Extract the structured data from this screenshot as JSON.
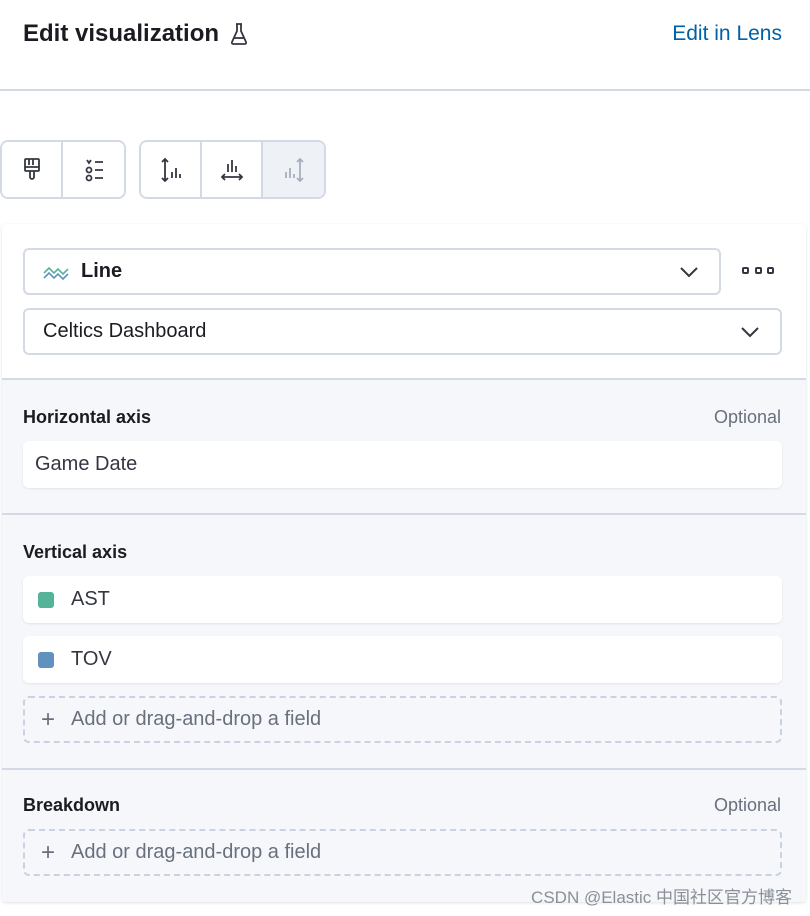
{
  "header": {
    "title": "Edit visualization",
    "edit_link": "Edit in Lens",
    "beaker_icon": "beaker-icon"
  },
  "toolbar": {
    "group1": [
      "paintbrush-icon",
      "legend-icon"
    ],
    "group2": [
      "left-axis-icon",
      "bottom-axis-icon",
      "right-axis-icon"
    ],
    "disabled": [
      "right-axis-icon"
    ]
  },
  "chart_type": {
    "label": "Line",
    "icon": "line-chart-icon"
  },
  "data_view": {
    "label": "Celtics Dashboard"
  },
  "horizontal_axis": {
    "title": "Horizontal axis",
    "optional": "Optional",
    "field": "Game Date"
  },
  "vertical_axis": {
    "title": "Vertical axis",
    "fields": [
      {
        "label": "AST",
        "color": "#54b399"
      },
      {
        "label": "TOV",
        "color": "#6092c0"
      }
    ],
    "drop_label": "Add or drag-and-drop a field"
  },
  "breakdown": {
    "title": "Breakdown",
    "optional": "Optional",
    "drop_label": "Add or drag-and-drop a field"
  },
  "watermark": "CSDN @Elastic 中国社区官方博客"
}
